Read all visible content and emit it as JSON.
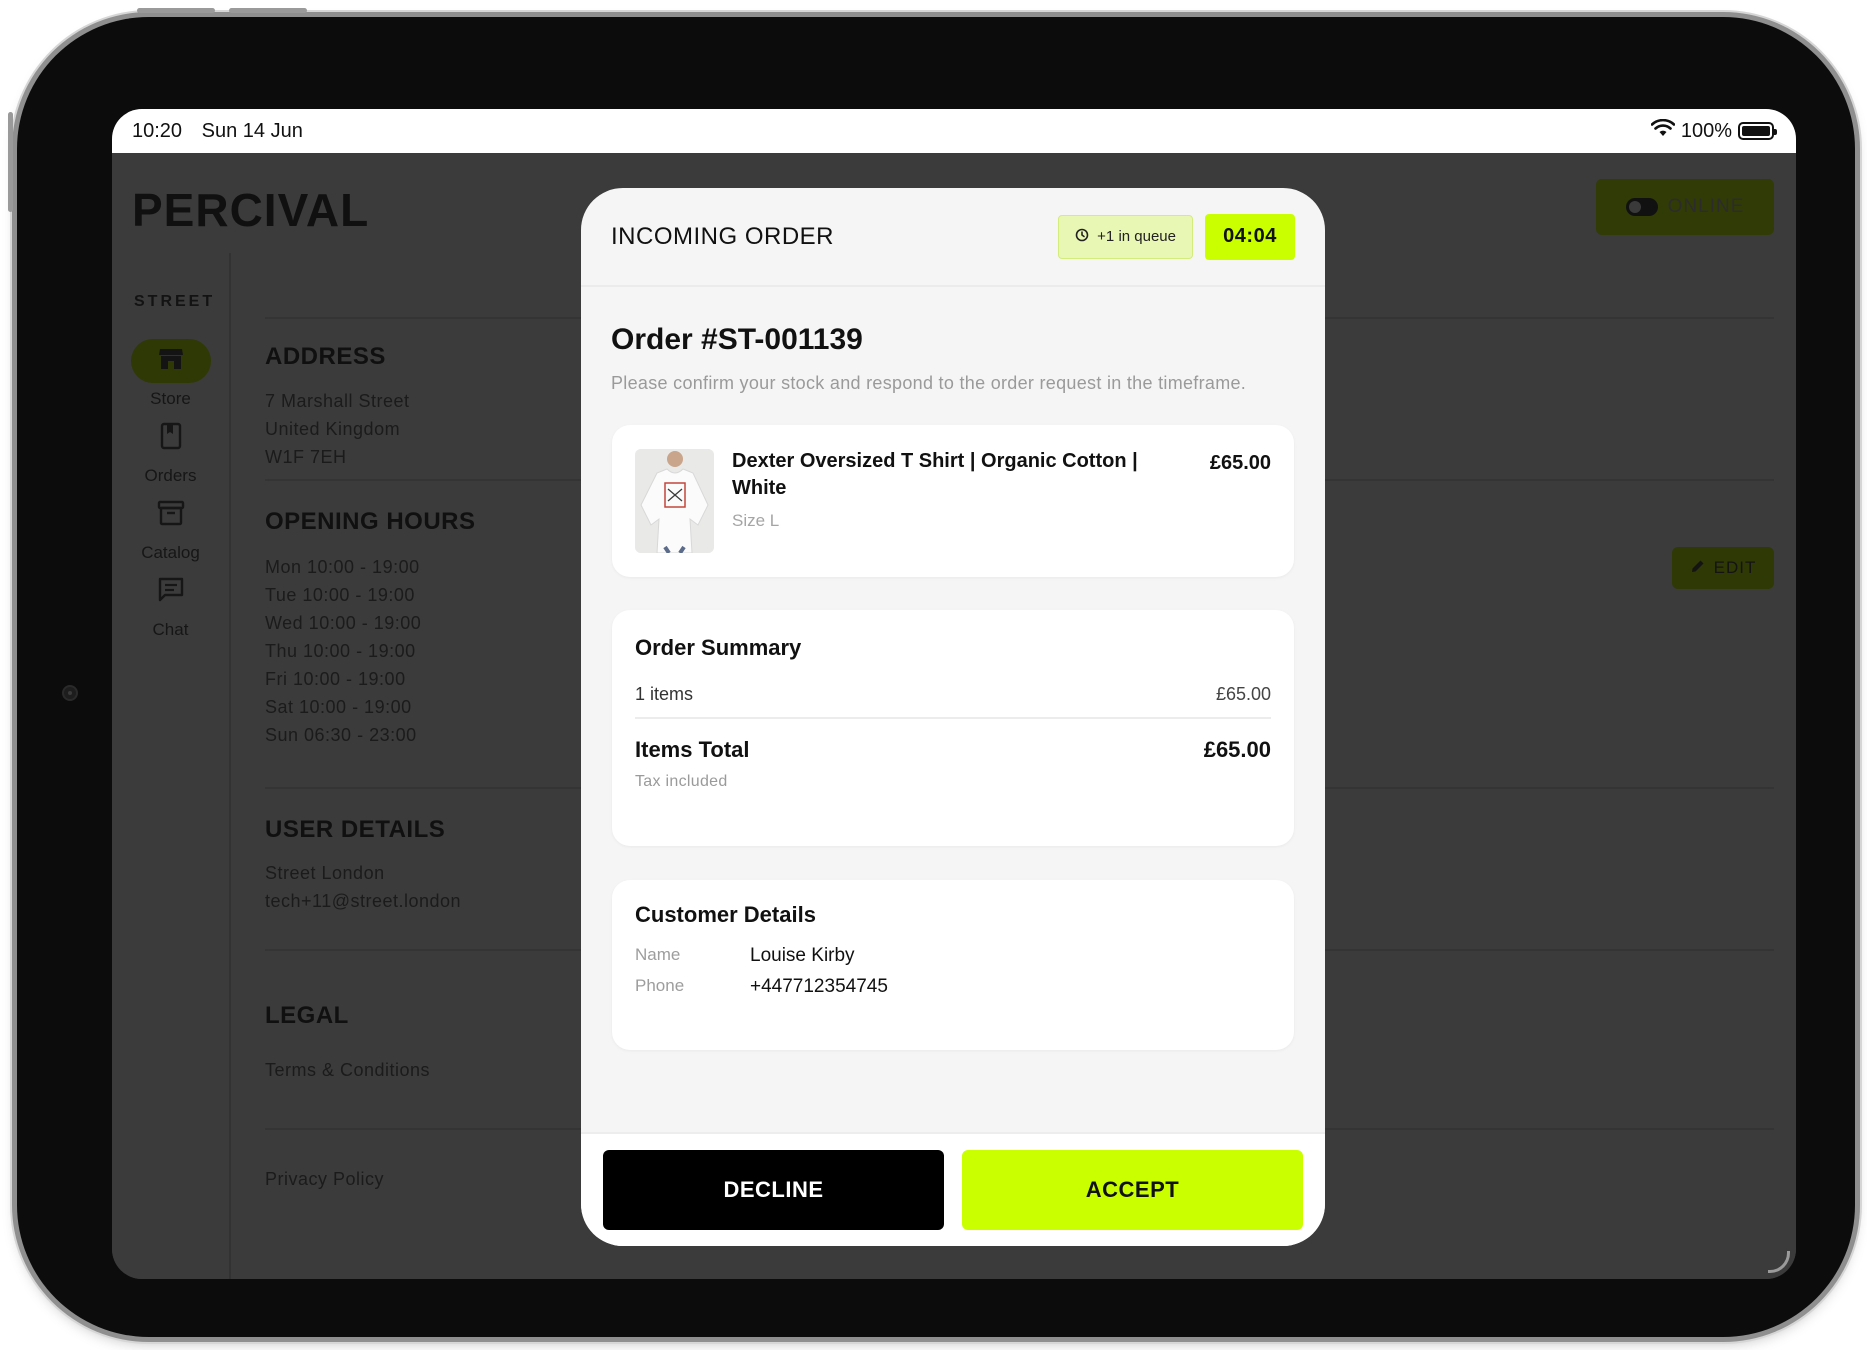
{
  "status_bar": {
    "time": "10:20",
    "date": "Sun 14 Jun",
    "battery": "100%"
  },
  "app": {
    "brand": "PERCIVAL",
    "online_label": "ONLINE",
    "sidebar_label": "STREET",
    "nav": [
      {
        "label": "Store",
        "icon": "store-icon",
        "active": true
      },
      {
        "label": "Orders",
        "icon": "orders-icon",
        "active": false
      },
      {
        "label": "Catalog",
        "icon": "catalog-icon",
        "active": false
      },
      {
        "label": "Chat",
        "icon": "chat-icon",
        "active": false
      }
    ],
    "address": {
      "title": "ADDRESS",
      "line1": "7 Marshall Street",
      "line2": "United Kingdom",
      "line3": "W1F 7EH"
    },
    "opening_hours": {
      "title": "OPENING HOURS",
      "edit_label": "EDIT",
      "lines": [
        "Mon 10:00 - 19:00",
        "Tue 10:00 - 19:00",
        "Wed 10:00 - 19:00",
        "Thu 10:00 - 19:00",
        "Fri 10:00 - 19:00",
        "Sat 10:00 - 19:00",
        "Sun 06:30 - 23:00"
      ]
    },
    "user_details": {
      "title": "USER DETAILS",
      "name": "Street London",
      "email": "tech+11@street.london"
    },
    "legal": {
      "title": "LEGAL",
      "terms": "Terms & Conditions",
      "privacy": "Privacy Policy"
    }
  },
  "modal": {
    "title": "INCOMING ORDER",
    "queue_badge": "+1 in queue",
    "timer": "04:04",
    "order_title": "Order #ST-001139",
    "subtitle": "Please confirm your stock and respond to the order request in the timeframe.",
    "product": {
      "name": "Dexter Oversized T Shirt | Organic Cotton | White",
      "size": "Size L",
      "price": "£65.00"
    },
    "summary": {
      "title": "Order Summary",
      "items_label": "1 items",
      "items_value": "£65.00",
      "total_label": "Items Total",
      "total_value": "£65.00",
      "tax_note": "Tax included"
    },
    "customer": {
      "title": "Customer Details",
      "name_key": "Name",
      "name_value": "Louise Kirby",
      "phone_key": "Phone",
      "phone_value": "+447712354745"
    },
    "decline_label": "DECLINE",
    "accept_label": "ACCEPT"
  },
  "colors": {
    "accent": "#caff00",
    "decline": "#000000",
    "overlay": "#3b3b3b"
  }
}
